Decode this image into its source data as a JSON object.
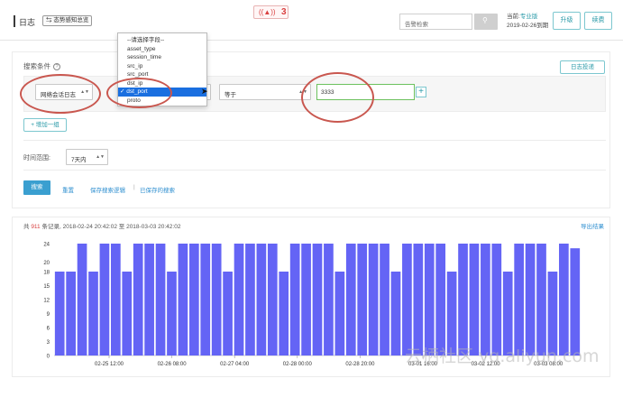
{
  "header": {
    "title": "日志",
    "switch_label": "态势感知总览",
    "alarm_count": "3",
    "search_placeholder": "告警检索",
    "version_prefix": "当前:",
    "version_edition": "专业版",
    "version_expiry": "2019-02-26到期",
    "upgrade_label": "升级",
    "renew_label": "续费"
  },
  "search": {
    "section_label": "搜索条件",
    "log_delivery_label": "日志投递",
    "log_type_value": "网络会话日志",
    "field_value": "dst_port",
    "operator_value": "等于",
    "query_value": "3333",
    "add_group_label": "+ 增加一组",
    "time_range_label": "时间范围:",
    "time_range_value": "7天内",
    "search_button": "搜索",
    "reset_link": "重置",
    "save_logic_link": "保存搜索逻辑",
    "divider": "|",
    "saved_search_link": "已保存的搜索"
  },
  "dropdown": {
    "options": [
      "--请选择字段--",
      "asset_type",
      "session_time",
      "src_ip",
      "src_port",
      "dst_ip",
      "✓ dst_port",
      "proto"
    ],
    "selected_index": 6
  },
  "results": {
    "summary_prefix": "共",
    "record_count": "911",
    "summary_suffix": "条记录, 2018-02-24 20:42:02 至 2018-03-03 20:42:02",
    "export_label": "导出结果"
  },
  "chart_data": {
    "type": "bar",
    "color": "#6464f5",
    "ylim": [
      0,
      24
    ],
    "yticks": [
      0,
      3,
      6,
      9,
      12,
      15,
      18,
      20,
      24
    ],
    "xtick_labels": [
      "02-25 12:00",
      "02-26 08:00",
      "02-27 04:00",
      "02-28 00:00",
      "02-28 20:00",
      "03-01 16:00",
      "03-02 12:00",
      "03-03 08:00"
    ],
    "values": [
      18,
      18,
      24,
      18,
      24,
      24,
      18,
      24,
      24,
      24,
      18,
      24,
      24,
      24,
      24,
      18,
      24,
      24,
      24,
      24,
      18,
      24,
      24,
      24,
      24,
      18,
      24,
      24,
      24,
      24,
      18,
      24,
      24,
      24,
      24,
      18,
      24,
      24,
      24,
      24,
      18,
      24,
      24,
      24,
      18,
      24,
      23
    ]
  },
  "watermark": "云栖社区 yq.aliyun.com"
}
